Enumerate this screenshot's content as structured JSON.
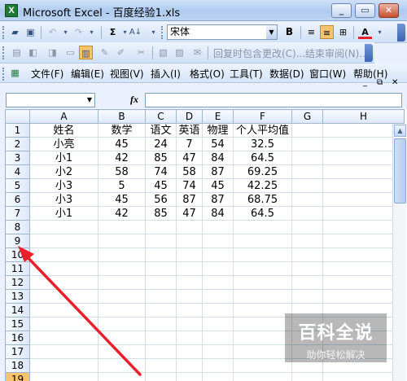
{
  "window": {
    "title": "Microsoft Excel - 百度经验1.xls",
    "app_icon": "X"
  },
  "standard_toolbar": {
    "font_name": "宋体",
    "bold": "B",
    "font_color_glyph": "A",
    "sum_glyph": "Σ"
  },
  "review_toolbar": {
    "reply_label": "回复时包含更改(C)...",
    "end_review_label": "结束审阅(N)..."
  },
  "menu": {
    "items": [
      "文件(F)",
      "编辑(E)",
      "视图(V)",
      "插入(I)",
      "格式(O)",
      "工具(T)",
      "数据(D)",
      "窗口(W)",
      "帮助(H)"
    ]
  },
  "formula_bar": {
    "fx_label": "fx",
    "name_box": "",
    "formula": ""
  },
  "sheet": {
    "columns": [
      "A",
      "B",
      "C",
      "D",
      "E",
      "F",
      "G",
      "H"
    ],
    "rows": [
      [
        "姓名",
        "数学",
        "语文",
        "英语",
        "物理",
        "个人平均值",
        "",
        ""
      ],
      [
        "小亮",
        "45",
        "24",
        "7",
        "54",
        "32.5",
        "",
        ""
      ],
      [
        "小1",
        "42",
        "85",
        "47",
        "84",
        "64.5",
        "",
        ""
      ],
      [
        "小2",
        "58",
        "74",
        "58",
        "87",
        "69.25",
        "",
        ""
      ],
      [
        "小3",
        "5",
        "45",
        "74",
        "45",
        "42.25",
        "",
        ""
      ],
      [
        "小3",
        "45",
        "56",
        "87",
        "87",
        "68.75",
        "",
        ""
      ],
      [
        "小1",
        "42",
        "85",
        "47",
        "84",
        "64.5",
        "",
        ""
      ],
      [
        "",
        "",
        "",
        "",
        "",
        "",
        "",
        ""
      ],
      [
        "",
        "",
        "",
        "",
        "",
        "",
        "",
        ""
      ],
      [
        "",
        "",
        "",
        "",
        "",
        "",
        "",
        ""
      ],
      [
        "",
        "",
        "",
        "",
        "",
        "",
        "",
        ""
      ],
      [
        "",
        "",
        "",
        "",
        "",
        "",
        "",
        ""
      ],
      [
        "",
        "",
        "",
        "",
        "",
        "",
        "",
        ""
      ],
      [
        "",
        "",
        "",
        "",
        "",
        "",
        "",
        ""
      ],
      [
        "",
        "",
        "",
        "",
        "",
        "",
        "",
        ""
      ],
      [
        "",
        "",
        "",
        "",
        "",
        "",
        "",
        ""
      ],
      [
        "",
        "",
        "",
        "",
        "",
        "",
        "",
        ""
      ],
      [
        "",
        "",
        "",
        "",
        "",
        "",
        "",
        ""
      ],
      [
        "",
        "",
        "",
        "",
        "",
        "",
        "",
        ""
      ]
    ],
    "row_numbers": [
      "1",
      "2",
      "3",
      "4",
      "5",
      "6",
      "7",
      "8",
      "9",
      "10",
      "11",
      "12",
      "13",
      "14",
      "15",
      "16",
      "17",
      "18",
      "19"
    ],
    "active_row": "19"
  },
  "watermark": {
    "title": "百科全说",
    "subtitle": "助你轻松解决"
  },
  "colors": {
    "annotation_arrow": "#e8202a",
    "active_row_header": "#f7c36b"
  }
}
